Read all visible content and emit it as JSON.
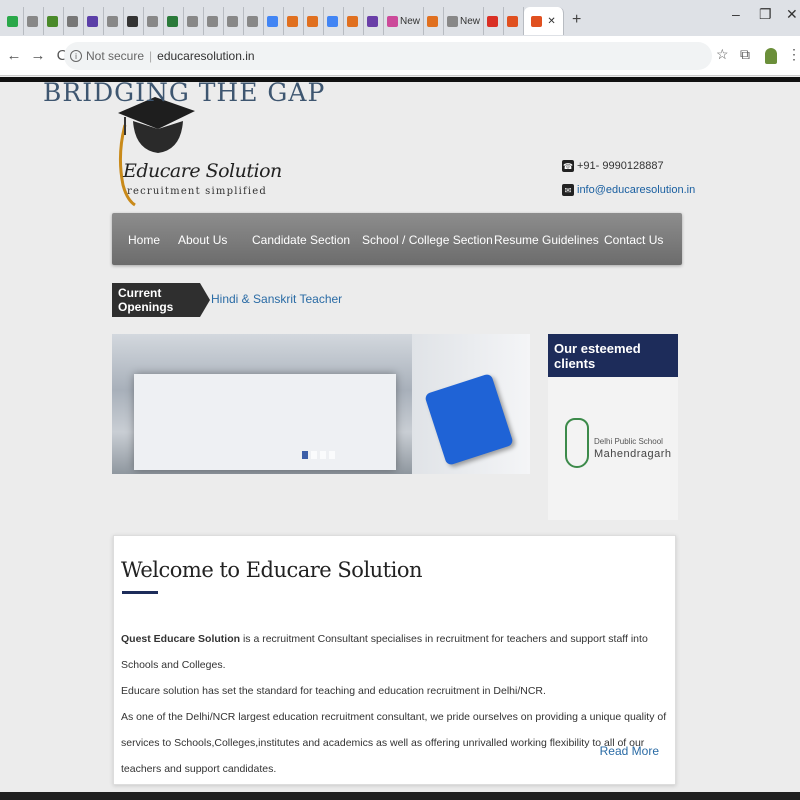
{
  "browser": {
    "tabs": [
      {
        "label": "",
        "color": "#2aa84a"
      },
      {
        "label": "",
        "color": "#888888"
      },
      {
        "label": "",
        "color": "#4a8a2a"
      },
      {
        "label": "",
        "color": "#777777"
      },
      {
        "label": "",
        "color": "#5b3fa8"
      },
      {
        "label": "",
        "color": "#888888"
      },
      {
        "label": "",
        "color": "#333333"
      },
      {
        "label": "",
        "color": "#888888"
      },
      {
        "label": "",
        "color": "#2a7a3a"
      },
      {
        "label": "",
        "color": "#888888"
      },
      {
        "label": "",
        "color": "#888888"
      },
      {
        "label": "",
        "color": "#888888"
      },
      {
        "label": "",
        "color": "#888888"
      },
      {
        "label": "",
        "color": "#4285f4"
      },
      {
        "label": "",
        "color": "#e07020"
      },
      {
        "label": "",
        "color": "#e07020"
      },
      {
        "label": "",
        "color": "#4285f4"
      },
      {
        "label": "",
        "color": "#e07020"
      },
      {
        "label": "",
        "color": "#6a3fa8"
      },
      {
        "label": "New",
        "color": "#cc4a9a"
      },
      {
        "label": "",
        "color": "#e07020"
      },
      {
        "label": "New",
        "color": "#888888"
      },
      {
        "label": "",
        "color": "#d93025"
      },
      {
        "label": "",
        "color": "#e05020"
      }
    ],
    "active_tab_label": "",
    "new_tab": "+",
    "window_controls": {
      "minimize": "–",
      "restore": "❐",
      "close": "✕"
    },
    "nav": {
      "back": "←",
      "forward": "→",
      "reload": "C"
    },
    "address": {
      "security": "Not secure",
      "url": "educaresolution.in"
    }
  },
  "site": {
    "logo": {
      "title": "Educare Solution",
      "tagline": "recruitment simplified"
    },
    "contact": {
      "phone": "+91- 9990128887",
      "email": "info@educaresolution.in"
    },
    "nav": [
      "Home",
      "About Us",
      "Candidate Section",
      "School / College Section",
      "Resume Guidelines",
      "Contact Us"
    ],
    "openings": {
      "label": "Current Openings",
      "text": "Hindi & Sanskrit Teacher"
    },
    "banner": {
      "text": "BRIDGING THE GAP"
    },
    "clients": {
      "heading": "Our esteemed clients",
      "client_name": "Delhi Public School",
      "client_place": "Mahendragarh"
    },
    "welcome": {
      "heading": "Welcome to Educare Solution",
      "bold_lead": "Quest Educare Solution",
      "p1": " is a recruitment Consultant specialises in recruitment for teachers and support staff into Schools and Colleges.",
      "p2": "Educare solution has set the standard for teaching and education recruitment in Delhi/NCR.",
      "p3": "As one of the Delhi/NCR largest education recruitment consultant, we pride ourselves on providing a unique quality of services to Schools,Colleges,institutes and academics as well as offering unrivalled working flexibility to all of our teachers and support candidates.",
      "read_more": "Read More"
    }
  }
}
